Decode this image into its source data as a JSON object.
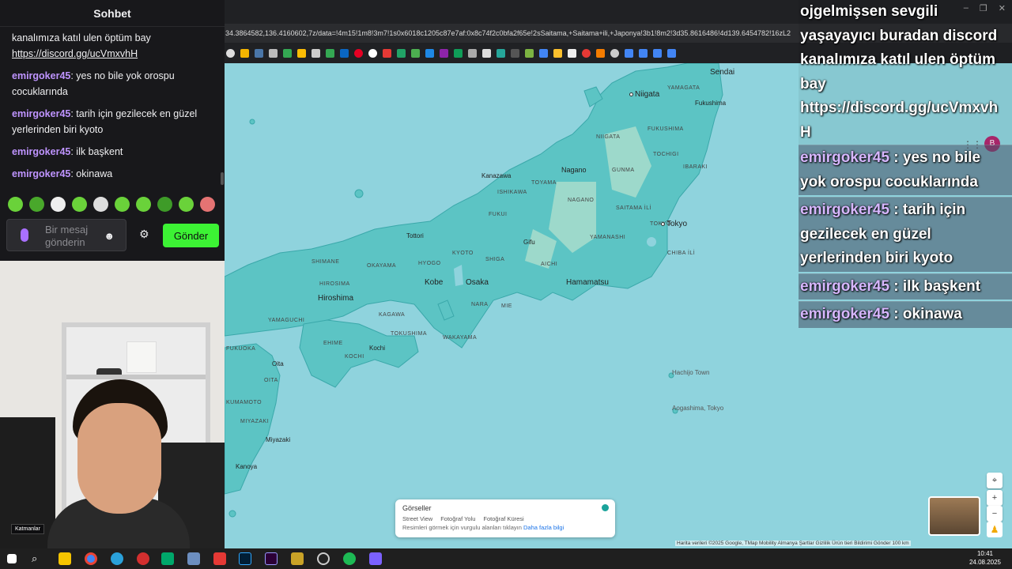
{
  "chat": {
    "header": "Sohbet",
    "first_line": "kanalımıza katıl ulen öptüm bay",
    "link": "https://discord.gg/ucVmxvhH",
    "messages": [
      {
        "user": "emirgoker45",
        "text": ": yes no bile yok orospu cocuklarında"
      },
      {
        "user": "emirgoker45",
        "text": ": tarih için gezilecek en güzel yerlerinden biri kyoto"
      },
      {
        "user": "emirgoker45",
        "text": ": ilk başkent"
      },
      {
        "user": "emirgoker45",
        "text": ": okinawa"
      }
    ],
    "input_placeholder": "Bir mesaj gönderin",
    "send_label": "Gönder"
  },
  "browser": {
    "url": "34.3864582,136.4160602,7z/data=!4m15!1m8!3m7!1s0x6018c1205c87e7af:0x8c74f2c0bfa2f65e!2sSaitama,+Saitama+ili,+Japonya!3b1!8m2!3d35.8616486!4d139.6454782!16zL2",
    "profile_initial": "B"
  },
  "map": {
    "cities": [
      "Sendai",
      "Niigata",
      "Fukushima",
      "Kanazawa",
      "Nagano",
      "Tokyo",
      "Tottori",
      "Kobe",
      "Osaka",
      "Hiroshima",
      "Hamamatsu",
      "Kochi",
      "Oita",
      "Miyazaki",
      "Kanoya",
      "Hachijo Town",
      "Aogashima, Tokyo",
      "Gifu"
    ],
    "prefectures": [
      "YAMAGATA",
      "FUKUSHIMA",
      "NIIGATA",
      "TOCHIGI",
      "IBARAKI",
      "GUNMA",
      "TOYAMA",
      "ISHIKAWA",
      "FUKUI",
      "NAGANO",
      "SAITAMA İLİ",
      "TOKYO",
      "CHIBA İLİ",
      "YAMANASHI",
      "SHIGA",
      "AICHI",
      "KYOTO",
      "HYOGO",
      "SHIMANE",
      "OKAYAMA",
      "HIROSIMA",
      "YAMAGUCHI",
      "KAGAWA",
      "TOKUSHIMA",
      "EHIME",
      "KOCHI",
      "WAKAYAMA",
      "NARA",
      "MIE",
      "OITA",
      "MIYAZAKI",
      "KUMAMOTO",
      "FUKUOKA"
    ],
    "gorseller": {
      "title": "Görseller",
      "legend": [
        "Street View",
        "Fotoğraf Yolu",
        "Fotoğraf Küresi"
      ],
      "note": "Resimleri görmek için vurgulu alanları tıklayın",
      "link": "Daha fazla bilgi"
    },
    "attribution": "Harita verileri ©2025 Google, TMap Mobility   Almanya   Şartlar   Gizlilik   Ürün tieri Bildirimi Gönder   100 km"
  },
  "webcam": {
    "layers_label": "Katmanlar"
  },
  "overlay": {
    "header_lines": [
      "ojgelmişsen sevgili",
      "yaşayayıcı buradan discord",
      "kanalımıza katıl ulen öptüm",
      "bay",
      "https://discord.gg/ucVmxvh",
      "H"
    ],
    "messages": [
      {
        "user": "emirgoker45",
        "text": " : yes no bile yok orospu cocuklarında"
      },
      {
        "user": "emirgoker45",
        "text": " : tarih için gezilecek en güzel yerlerinden biri kyoto"
      },
      {
        "user": "emirgoker45",
        "text": " : ilk başkent"
      },
      {
        "user": "emirgoker45",
        "text": " : okinawa"
      }
    ]
  },
  "taskbar": {
    "time": "10:41",
    "date": "24.08.2025"
  }
}
